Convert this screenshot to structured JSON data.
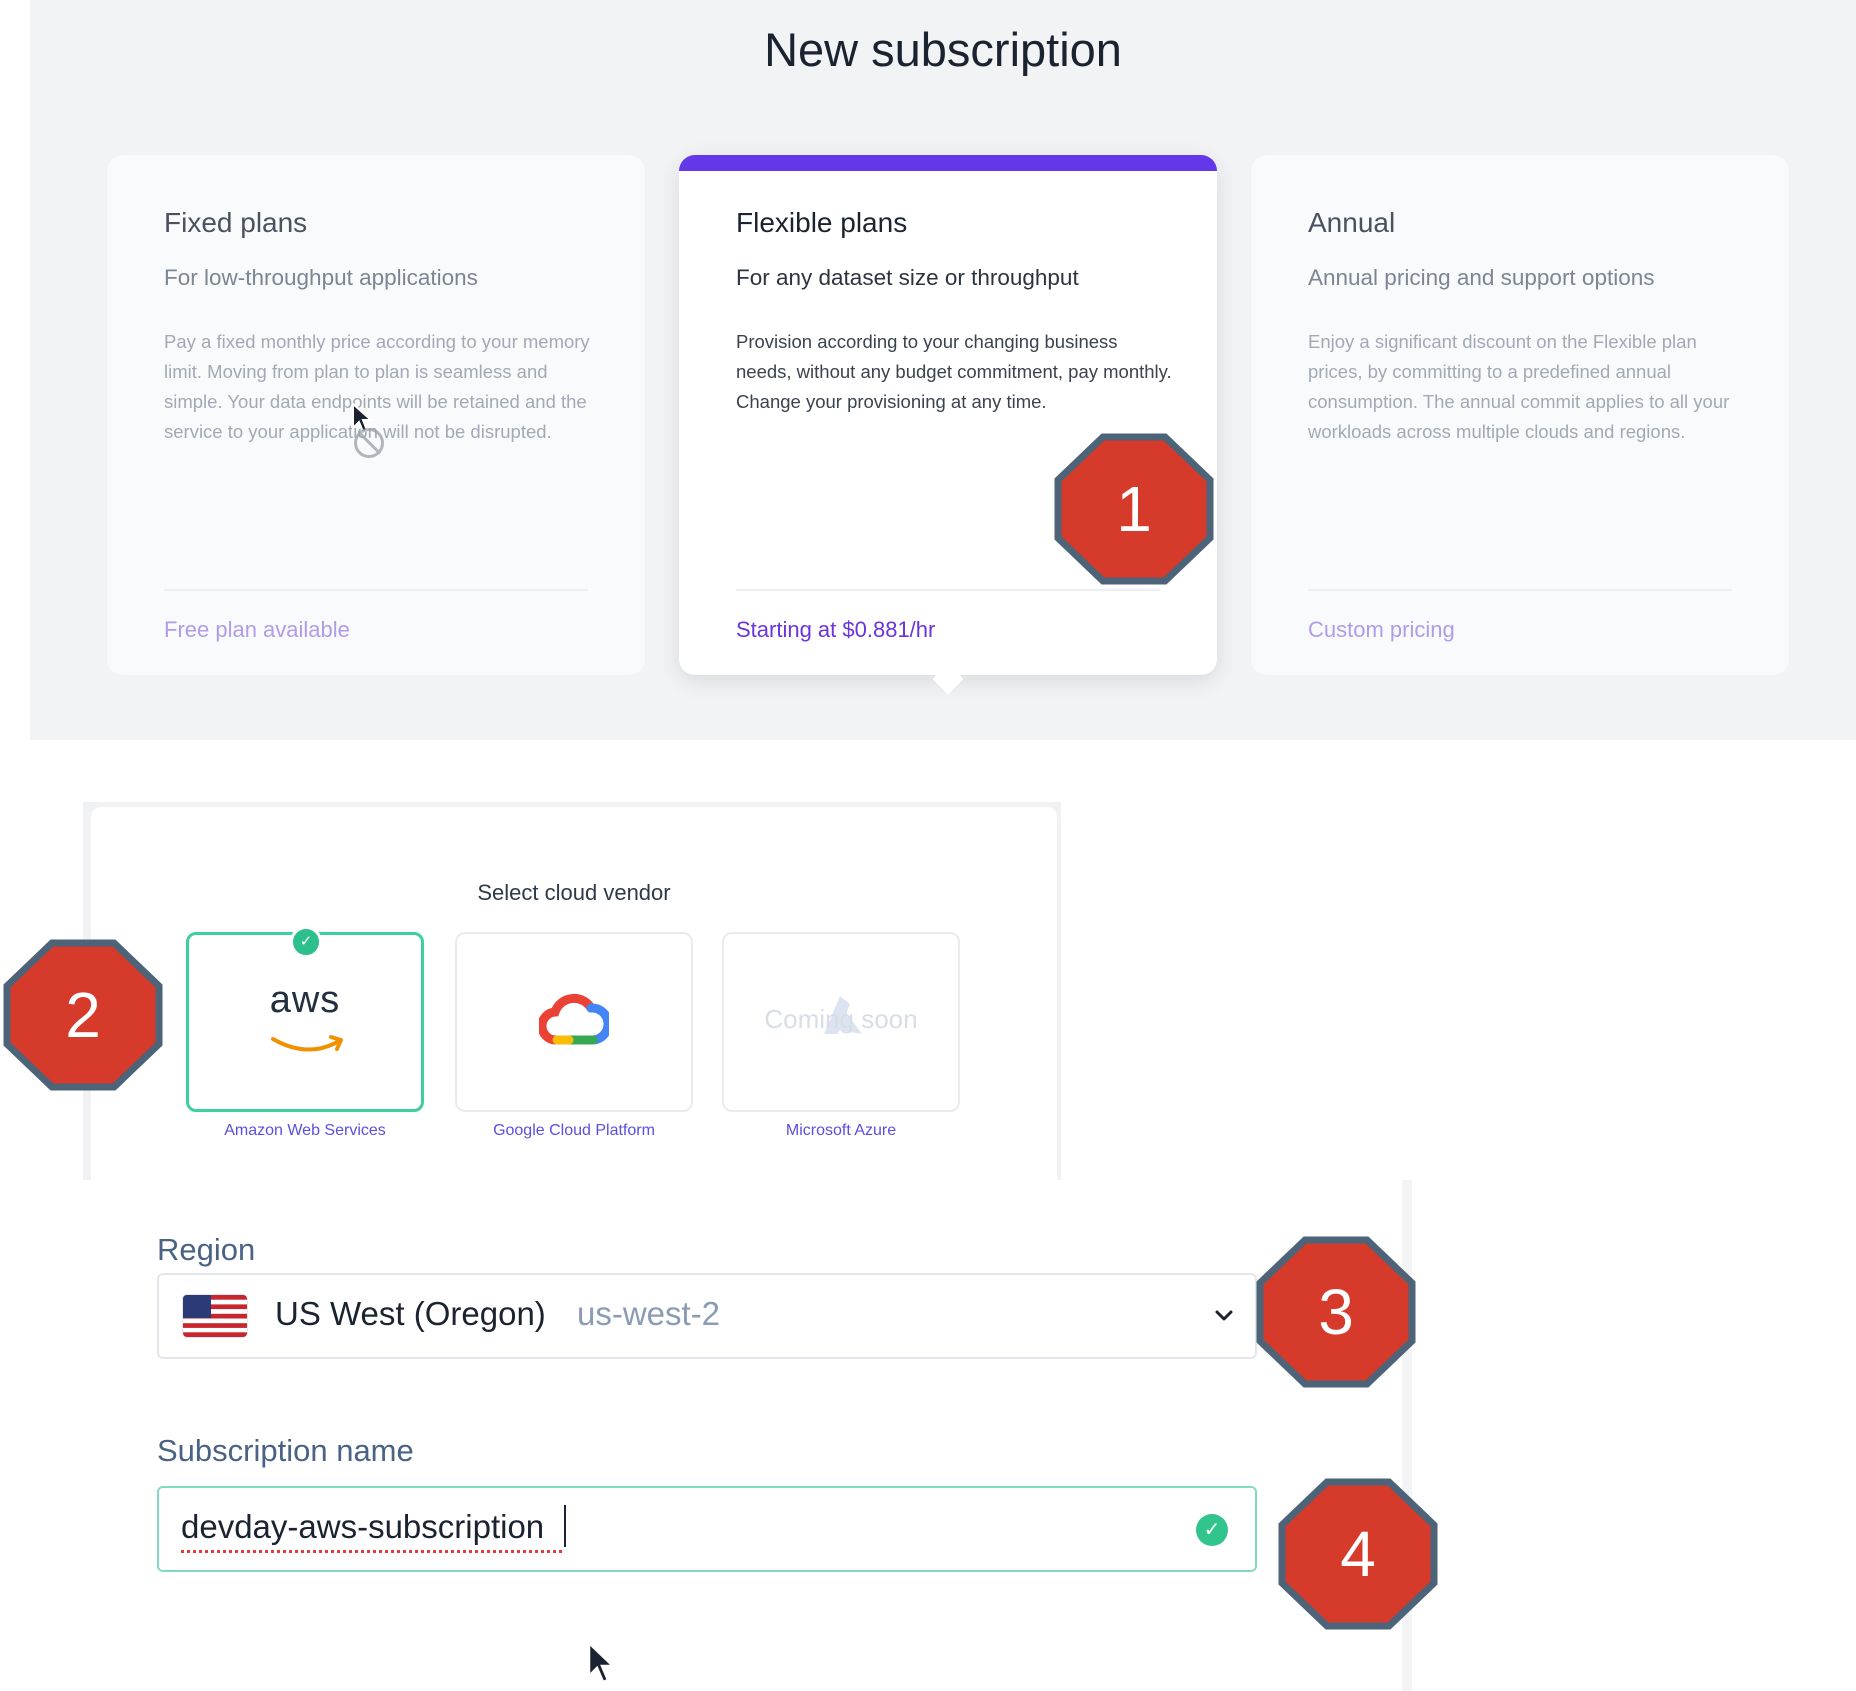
{
  "page": {
    "title": "New subscription"
  },
  "plans": [
    {
      "title": "Fixed plans",
      "subtitle": "For low-throughput applications",
      "description": "Pay a fixed monthly price according to your memory limit. Moving from plan to plan is seamless and simple. Your data endpoints will be retained and the service to your application will not be disrupted.",
      "price": "Free plan available",
      "selected": false
    },
    {
      "title": "Flexible plans",
      "subtitle": "For any dataset size or throughput",
      "description": "Provision according to your changing business needs, without any budget commitment, pay monthly. Change your provisioning at any time.",
      "price": "Starting at $0.881/hr",
      "selected": true
    },
    {
      "title": "Annual",
      "subtitle": "Annual pricing and support options",
      "description": "Enjoy a significant discount on the Flexible plan prices, by committing to a predefined annual consumption. The annual commit applies to all your workloads across multiple clouds and regions.",
      "price": "Custom pricing",
      "selected": false
    }
  ],
  "vendor": {
    "heading": "Select cloud vendor",
    "options": [
      {
        "name": "Amazon Web Services",
        "logo_text": "aws",
        "icon": "aws-logo-icon",
        "selected": true
      },
      {
        "name": "Google Cloud Platform",
        "icon": "google-cloud-icon",
        "selected": false
      },
      {
        "name": "Microsoft Azure",
        "overlay": "Coming soon",
        "icon": "azure-icon",
        "selected": false,
        "disabled": true
      }
    ]
  },
  "region": {
    "label": "Region",
    "flag_icon": "us-flag-icon",
    "name": "US West (Oregon)",
    "code": "us-west-2"
  },
  "subscription_name": {
    "label": "Subscription name",
    "value": "devday-aws-subscription"
  },
  "markers": [
    "1",
    "2",
    "3",
    "4"
  ],
  "colors": {
    "accent": "#6438e8",
    "price_link": "#6a34e0",
    "success": "#32c48d",
    "marker_fill": "#d63a2b",
    "marker_border": "#4d6378"
  }
}
